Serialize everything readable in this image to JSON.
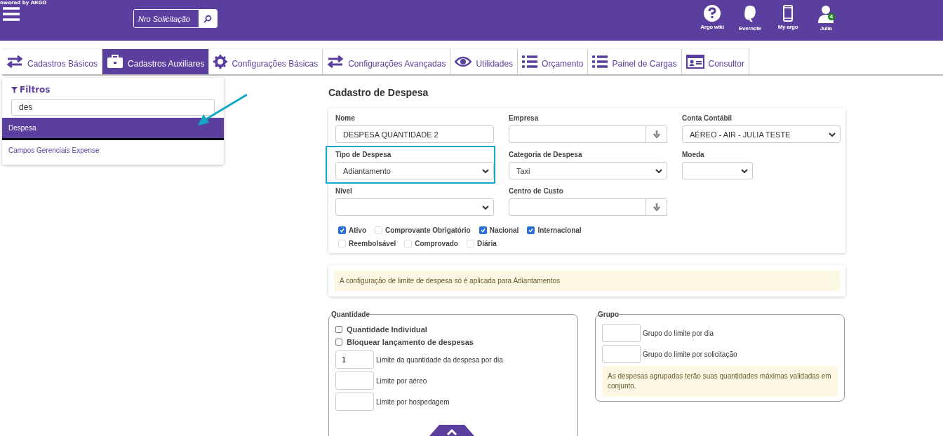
{
  "header": {
    "powered_by": "owered by ARGO",
    "search": {
      "placeholder": "Nro Solicitação"
    },
    "shortcuts": [
      {
        "kind": "help",
        "label": "Argo wiki"
      },
      {
        "kind": "note",
        "label": "Evernote"
      },
      {
        "kind": "phone",
        "label": "My argo"
      },
      {
        "kind": "user",
        "label": "Julia",
        "badge": "4"
      }
    ]
  },
  "tabs": [
    {
      "kind": "arrows",
      "label": "Cadastros Básicos",
      "selected": false
    },
    {
      "kind": "briefcase",
      "label": "Cadastros Auxiliares",
      "selected": true
    },
    {
      "kind": "gear",
      "label": "Configurações Básicas",
      "selected": false
    },
    {
      "kind": "arrows",
      "label": "Configurações Avançadas",
      "selected": false
    },
    {
      "kind": "eye",
      "label": "Utilidades",
      "selected": false
    },
    {
      "kind": "list",
      "label": "Orçamento",
      "selected": false
    },
    {
      "kind": "list",
      "label": "Painel de Cargas",
      "selected": false
    },
    {
      "kind": "card",
      "label": "Consultor",
      "selected": false
    }
  ],
  "sidebar": {
    "title": "Filtros",
    "filter_value": "des",
    "items": [
      {
        "label": "Despesa",
        "selected": true
      },
      {
        "label": "Campos Gerenciais Expense",
        "selected": false
      }
    ]
  },
  "form": {
    "title": "Cadastro de Despesa",
    "fields": [
      {
        "label": "Nome",
        "kind": "text",
        "value": "DESPESA QUANTIDADE 2"
      },
      {
        "label": "Empresa",
        "kind": "lookup"
      },
      {
        "label": "Conta Contábil",
        "kind": "select",
        "value": "AÉREO - AIR - JULIA TESTE"
      },
      {
        "label": "Tipo de Despesa",
        "kind": "select",
        "value": "Adiantamento",
        "highlighted": true
      },
      {
        "label": "Categoria de Despesa",
        "kind": "select",
        "value": "Taxi"
      },
      {
        "label": "Moeda",
        "kind": "select-small"
      },
      {
        "label": "Nivel",
        "kind": "select"
      },
      {
        "label": "Centro de Custo",
        "kind": "lookup"
      }
    ],
    "checkboxes": [
      [
        {
          "label": "Ativo",
          "checked": true
        },
        {
          "label": "Comprovante Obrigatório",
          "checked": false
        },
        {
          "label": "Nacional",
          "checked": true
        },
        {
          "label": "Internacional",
          "checked": true
        }
      ],
      [
        {
          "label": "Reembolsável",
          "checked": false
        },
        {
          "label": "Comprovado",
          "checked": false
        },
        {
          "label": "Diária",
          "checked": false
        }
      ]
    ],
    "notice": "A configuração de limite de despesa só é aplicada para Adiantamentos",
    "quantidade": {
      "title": "Quantidade",
      "checkboxes": [
        {
          "label": "Quantidade Individual",
          "checked": false
        },
        {
          "label": "Bloquear lançamento de despesas",
          "checked": false
        }
      ],
      "limits": [
        {
          "value": "1",
          "label": "Limite da quantidade da despesa por dia"
        },
        {
          "label": "Limite por aéreo"
        },
        {
          "label": "Limite por hospedagem"
        }
      ]
    },
    "grupo": {
      "title": "Grupo",
      "limits": [
        {
          "label": "Grupo do limite por dia"
        },
        {
          "label": "Grupo do limite por solicitação"
        }
      ],
      "note": "As despesas agrupadas terão suas quantidades máximas validadas em conjunto."
    }
  }
}
